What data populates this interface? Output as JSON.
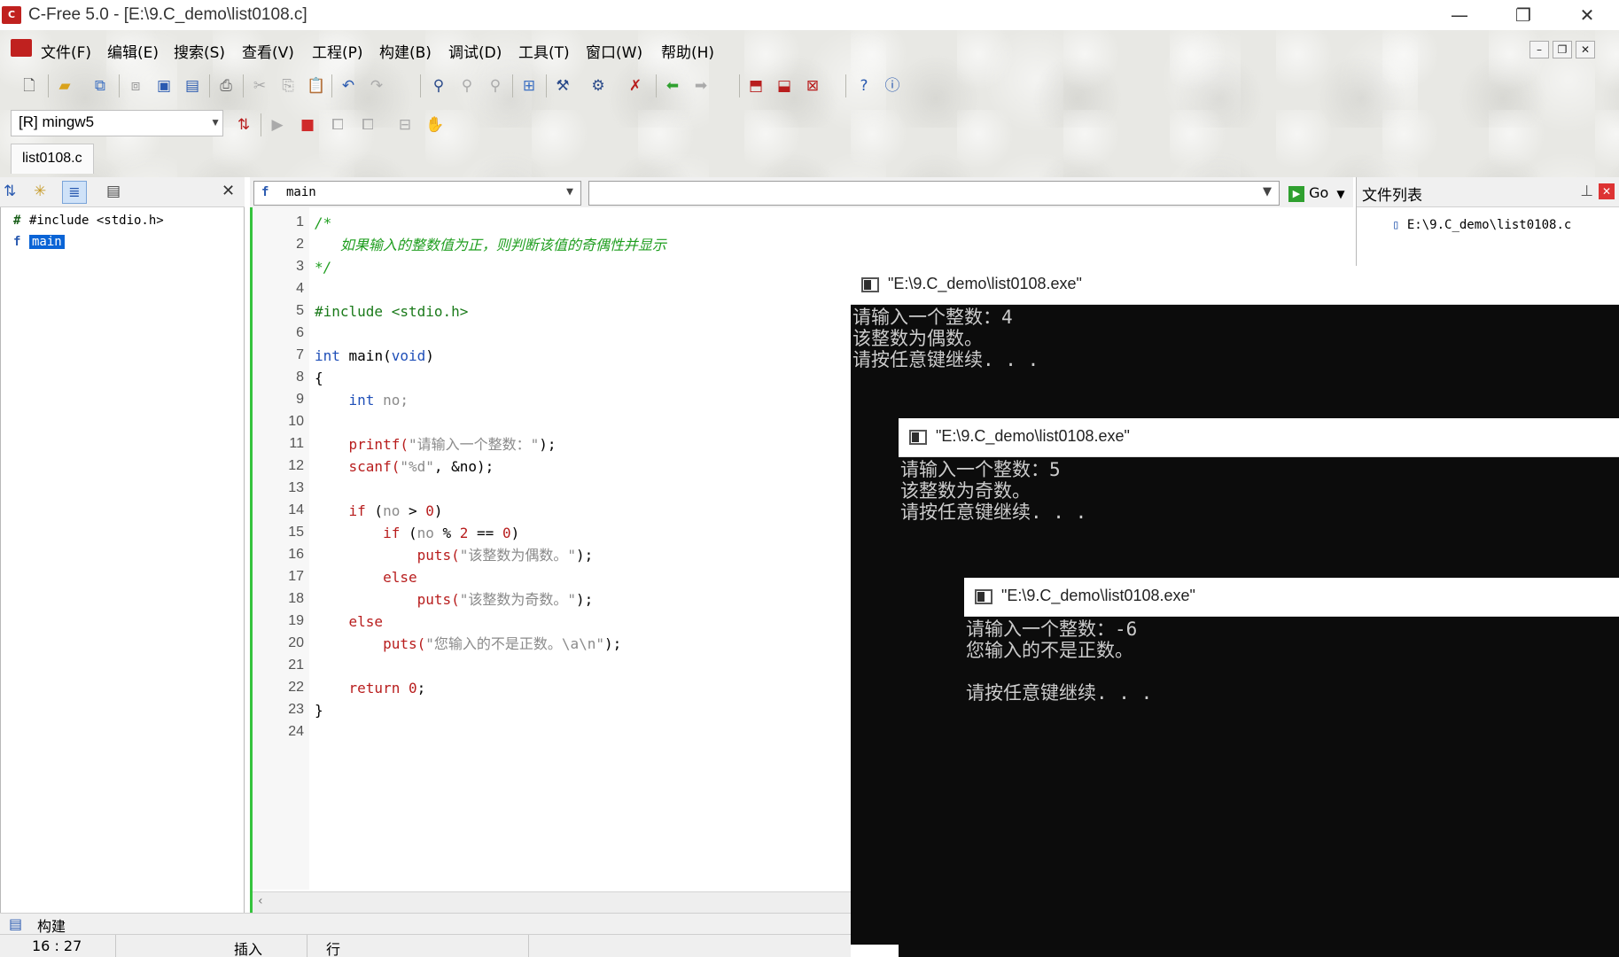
{
  "window": {
    "title": "C-Free 5.0 - [E:\\9.C_demo\\list0108.c]"
  },
  "menu": [
    "文件(F)",
    "编辑(E)",
    "搜索(S)",
    "查看(V)",
    "工程(P)",
    "构建(B)",
    "调试(D)",
    "工具(T)",
    "窗口(W)",
    "帮助(H)"
  ],
  "toolbar2": {
    "compiler": "[R] mingw5"
  },
  "doc_tab": "list0108.c",
  "left_tree": {
    "include": "#include <stdio.h>",
    "main": "main"
  },
  "editor": {
    "func_combo": "main",
    "go_label": "Go",
    "line_numbers": [
      "1",
      "2",
      "3",
      "4",
      "5",
      "6",
      "7",
      "8",
      "9",
      "10",
      "11",
      "12",
      "13",
      "14",
      "15",
      "16",
      "17",
      "18",
      "19",
      "20",
      "21",
      "22",
      "23",
      "24"
    ],
    "lines": {
      "l1": "/*",
      "l2": "   如果输入的整数值为正，则判断该值的奇偶性并显示",
      "l3": "*/",
      "l5": "#include <stdio.h>",
      "l7a": "int",
      "l7b": " main(",
      "l7c": "void",
      "l7d": ")",
      "l8": "{",
      "l9a": "    int",
      "l9b": " no;",
      "l11a": "    printf(",
      "l11b": "\"请输入一个整数：\"",
      "l11c": ");",
      "l12a": "    scanf(",
      "l12b": "\"%d\"",
      "l12c": ", &no);",
      "l14a": "    if",
      "l14b": " (",
      "l14c": "no",
      "l14d": " > ",
      "l14e": "0",
      "l14f": ")",
      "l15a": "        if",
      "l15b": " (",
      "l15c": "no",
      "l15d": " % ",
      "l15e": "2",
      "l15f": " == ",
      "l15g": "0",
      "l15h": ")",
      "l16a": "            puts(",
      "l16b": "\"该整数为偶数。\"",
      "l16c": ");",
      "l17": "        else",
      "l18a": "            puts(",
      "l18b": "\"该整数为奇数。\"",
      "l18c": ");",
      "l19": "    else",
      "l20a": "        puts(",
      "l20b": "\"您输入的不是正数。\\a\\n\"",
      "l20c": ");",
      "l22a": "    return",
      "l22b": " ",
      "l22c": "0",
      "l22d": ";",
      "l23": "}"
    }
  },
  "file_list": {
    "title": "文件列表",
    "item": "E:\\9.C_demo\\list0108.c"
  },
  "status": {
    "build_tab": "构建",
    "position": "16 : 27",
    "mode": "插入",
    "unit": "行"
  },
  "consoles": [
    {
      "title": "\"E:\\9.C_demo\\list0108.exe\"",
      "lines": [
        "请输入一个整数：4",
        "该整数为偶数。",
        "请按任意键继续. . ."
      ]
    },
    {
      "title": "\"E:\\9.C_demo\\list0108.exe\"",
      "lines": [
        "请输入一个整数：5",
        "该整数为奇数。",
        "请按任意键继续. . ."
      ]
    },
    {
      "title": "\"E:\\9.C_demo\\list0108.exe\"",
      "lines": [
        "请输入一个整数：-6",
        "您输入的不是正数。",
        "",
        "请按任意键继续. . ."
      ]
    }
  ],
  "icons": [
    "app-icon",
    "new-file-icon",
    "open-folder-icon",
    "save-icon",
    "print-icon",
    "cut-icon",
    "copy-icon",
    "paste-icon",
    "undo-icon",
    "redo-icon",
    "find-icon",
    "compile-icon",
    "run-icon",
    "stop-icon",
    "help-icon",
    "info-icon",
    "go-icon"
  ],
  "colors": {
    "accent_green": "#35c33d",
    "comment": "#1f9e1f",
    "keyword": "#1f4fb8",
    "keyword_red": "#b81d1d",
    "console_bg": "#0c0c0c"
  }
}
